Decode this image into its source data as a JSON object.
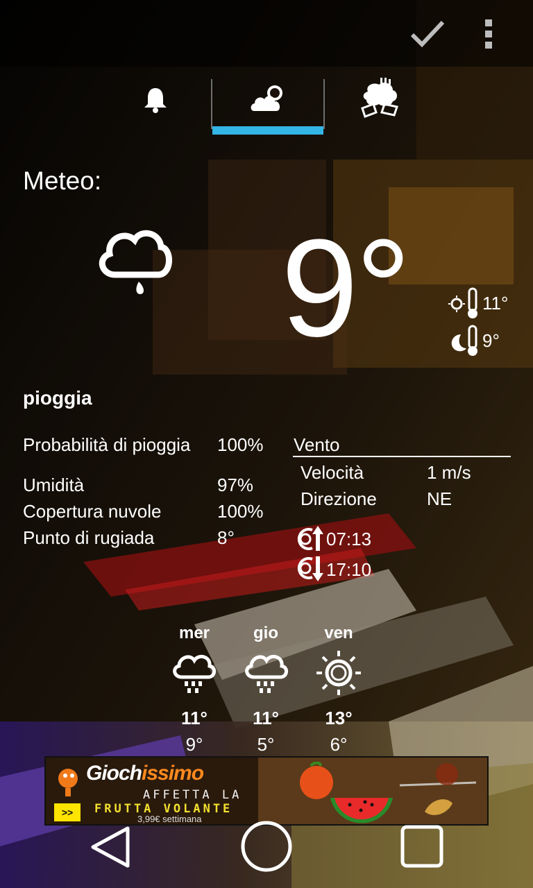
{
  "colors": {
    "accent": "#33b5e5",
    "text": "#ffffff"
  },
  "action_bar": {
    "confirm_icon": "check-icon",
    "menu_icon": "overflow-menu-icon"
  },
  "tabs": [
    {
      "name": "alarm",
      "icon": "bell-icon",
      "selected": false
    },
    {
      "name": "weather",
      "icon": "cloud-icon",
      "selected": true
    },
    {
      "name": "horoscope",
      "icon": "sheep-icon",
      "selected": false
    }
  ],
  "weather": {
    "title": "Meteo:",
    "current_icon": "rain-cloud-icon",
    "temperature": "9°",
    "high": "11°",
    "low": "9°",
    "condition": "pioggia",
    "stats": [
      {
        "label": "Probabilità di pioggia",
        "value": "100%"
      },
      {
        "label": "Umidità",
        "value": "97%"
      },
      {
        "label": "Copertura nuvole",
        "value": "100%"
      },
      {
        "label": "Punto di rugiada",
        "value": "8°"
      }
    ],
    "wind": {
      "title": "Vento",
      "speed_label": "Velocità",
      "speed_value": "1 m/s",
      "direction_label": "Direzione",
      "direction_value": "NE"
    },
    "sunrise": "07:13",
    "sunset": "17:10",
    "forecast": [
      {
        "day": "mer",
        "icon": "rain-icon",
        "high": "11°",
        "low": "9°"
      },
      {
        "day": "gio",
        "icon": "rain-icon",
        "high": "11°",
        "low": "5°"
      },
      {
        "day": "ven",
        "icon": "sun-icon",
        "high": "13°",
        "low": "6°"
      }
    ]
  },
  "ad": {
    "brand_a": "Gioch",
    "brand_b": "issimo",
    "line1": "AFFETTA LA",
    "line2": "FRUTTA VOLANTE",
    "price": "3,99€ settimana",
    "button": ">>"
  },
  "navbar": {
    "back": "back-icon",
    "home": "home-icon",
    "recents": "recents-icon"
  }
}
